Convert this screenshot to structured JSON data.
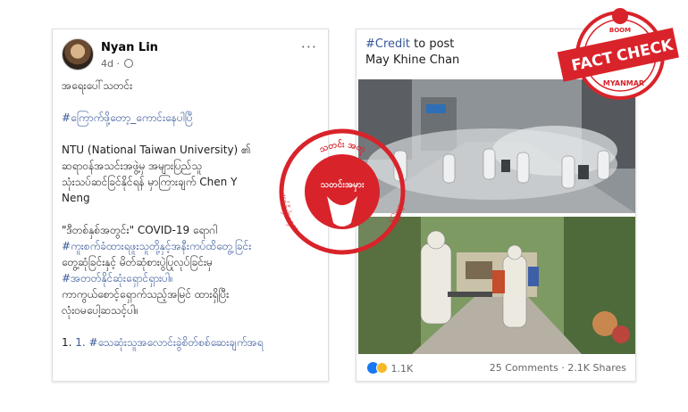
{
  "post": {
    "author": "Nyan Lin",
    "time": "4d",
    "more_label": "···",
    "lines": {
      "l1": "အရေးပေါ်သတင်း",
      "l2": "#ကြောက်ဖို့တော့_ကောင်းနေပါပြီ",
      "l3": "NTU (National Taiwan University) ၏",
      "l4": "ဆရာဝန်အသင်းအဖွဲ့မှ အများပြည်သူ",
      "l5": "သုံးသပ်ဆင်ခြင်နိုင်ရန် မှာကြားချက် Chen Y",
      "l6": "Neng",
      "l7": "\"ဒီတစ်နှစ်အတွင်း\" COVID-19 ရောဂါ",
      "l8": "#ကူးစက်ခံထားရဖူးသူတို့နှင့်အနီးကပ်ထိတွေ့ခြင်း",
      "l9": "တွေ့ဆုံခြင်းနှင့် မိတ်ဆုံစားပွဲပြုလုပ်ခြင်းမှ",
      "l10": "#အတတ်နိုင်ဆုံးရှောင်ရှားပါ။",
      "l11": "ကာကွယ်စောင့်ရှောက်သည့်အမြင် ထားရှိပြီး",
      "l12": "လုံးဝမပေါ့ဆသင့်ပါ။",
      "l13": "1. #သေဆုံးသူအလောင်းခွဲစိတ်စစ်ဆေးချက်အရ"
    }
  },
  "right": {
    "credit_tag": "#Credit",
    "credit_rest": " to post",
    "credit_name": "May Khine Chan",
    "reactions": "1.1K",
    "comments_shares": "25 Comments · 2.1K Shares"
  },
  "stamp": {
    "center_text": "သတင်းအမှား",
    "ring_top": "သတင်း အတု",
    "ring_left": "ထင်ရော်မှုမှား",
    "ring_right": "ဝါဒဖြန့်"
  },
  "badge": {
    "boom": "BOOM",
    "fact": "FACT",
    "check": "CHECK",
    "country": "MYANMAR"
  },
  "colors": {
    "stamp_red": "#d9232a",
    "link_blue": "#385898"
  }
}
